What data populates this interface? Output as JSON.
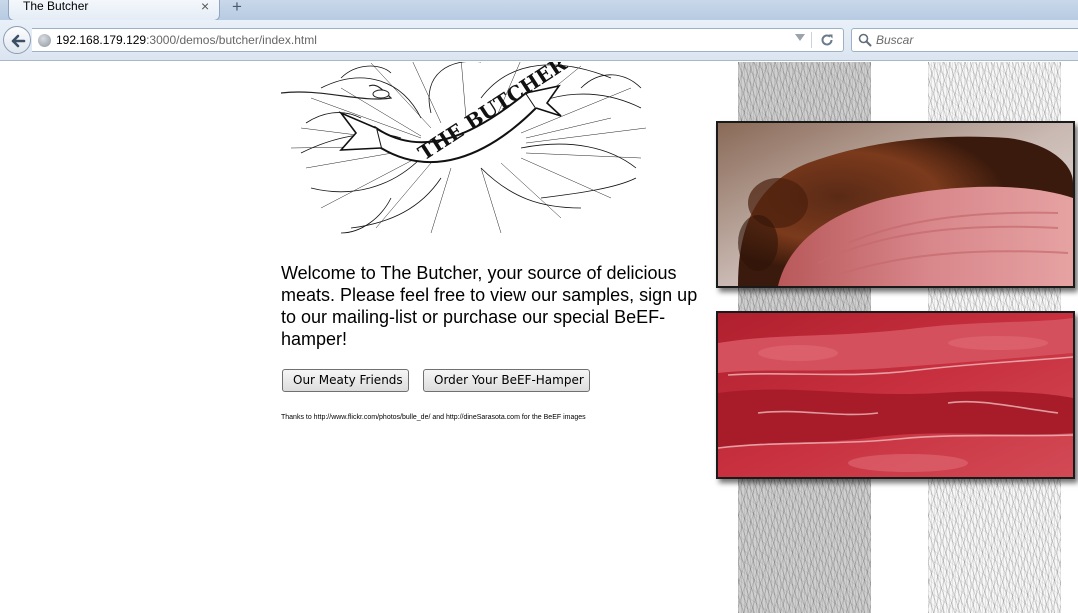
{
  "browser": {
    "tab_title": "The Butcher",
    "tab_close": "×",
    "new_tab": "+",
    "url_host": "192.168.179.129",
    "url_rest": ":3000/demos/butcher/index.html",
    "search_placeholder": "Buscar"
  },
  "logo": {
    "text": "THE BUTCHER"
  },
  "content": {
    "welcome": "Welcome to The Butcher, your source of delicious meats. Please feel free to view our samples, sign up to our mailing-list or purchase our special BeEF-hamper!",
    "button_friends": "Our Meaty Friends",
    "button_hamper": "Order Your BeEF-Hamper",
    "credits": "Thanks to http://www.flickr.com/photos/bulle_de/ and http://dineSarasota.com for the BeEF images"
  },
  "icons": [
    "back-arrow-icon",
    "globe-icon",
    "dropdown-icon",
    "reload-icon",
    "search-icon"
  ]
}
